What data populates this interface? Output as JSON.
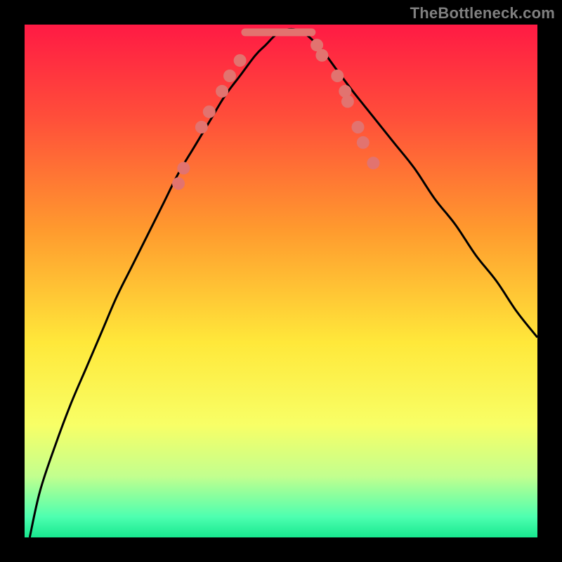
{
  "watermark": "TheBottleneck.com",
  "chart_data": {
    "type": "line",
    "title": "",
    "xlabel": "",
    "ylabel": "",
    "xlim": [
      0,
      100
    ],
    "ylim": [
      0,
      100
    ],
    "background_gradient": {
      "stops": [
        {
          "pct": 0,
          "color": "#ff1a44"
        },
        {
          "pct": 18,
          "color": "#ff4e3a"
        },
        {
          "pct": 40,
          "color": "#ff9a2e"
        },
        {
          "pct": 62,
          "color": "#ffe83a"
        },
        {
          "pct": 78,
          "color": "#f8ff66"
        },
        {
          "pct": 88,
          "color": "#c3ff8e"
        },
        {
          "pct": 96,
          "color": "#4dffb0"
        },
        {
          "pct": 100,
          "color": "#18e88f"
        }
      ]
    },
    "good_band": {
      "y_from": 95,
      "y_to": 100
    },
    "series": [
      {
        "name": "bottleneck-curve",
        "color": "#000000",
        "x": [
          1,
          3,
          6,
          9,
          12,
          15,
          18,
          21,
          24,
          27,
          30,
          33,
          36,
          39,
          42,
          45,
          47,
          49,
          51,
          53,
          55,
          58,
          61,
          64,
          68,
          72,
          76,
          80,
          84,
          88,
          92,
          96,
          100
        ],
        "y": [
          0,
          9,
          18,
          26,
          33,
          40,
          47,
          53,
          59,
          65,
          71,
          76,
          81,
          86,
          90,
          94,
          96,
          98,
          99,
          99,
          98,
          95,
          91,
          87,
          82,
          77,
          72,
          66,
          61,
          55,
          50,
          44,
          39
        ]
      }
    ],
    "scatter_points": {
      "color": "#e2736f",
      "radius": 9,
      "points": [
        {
          "x": 30,
          "y": 69
        },
        {
          "x": 31,
          "y": 72
        },
        {
          "x": 34.5,
          "y": 80
        },
        {
          "x": 36,
          "y": 83
        },
        {
          "x": 38.5,
          "y": 87
        },
        {
          "x": 40,
          "y": 90
        },
        {
          "x": 42,
          "y": 93
        },
        {
          "x": 57,
          "y": 96
        },
        {
          "x": 58,
          "y": 94
        },
        {
          "x": 61,
          "y": 90
        },
        {
          "x": 62.5,
          "y": 87
        },
        {
          "x": 63,
          "y": 85
        },
        {
          "x": 65,
          "y": 80
        },
        {
          "x": 66,
          "y": 77
        },
        {
          "x": 68,
          "y": 73
        }
      ]
    },
    "flat_segment": {
      "color": "#e2736f",
      "thickness": 11,
      "x_from": 43,
      "x_to": 56,
      "y": 98.5
    }
  }
}
